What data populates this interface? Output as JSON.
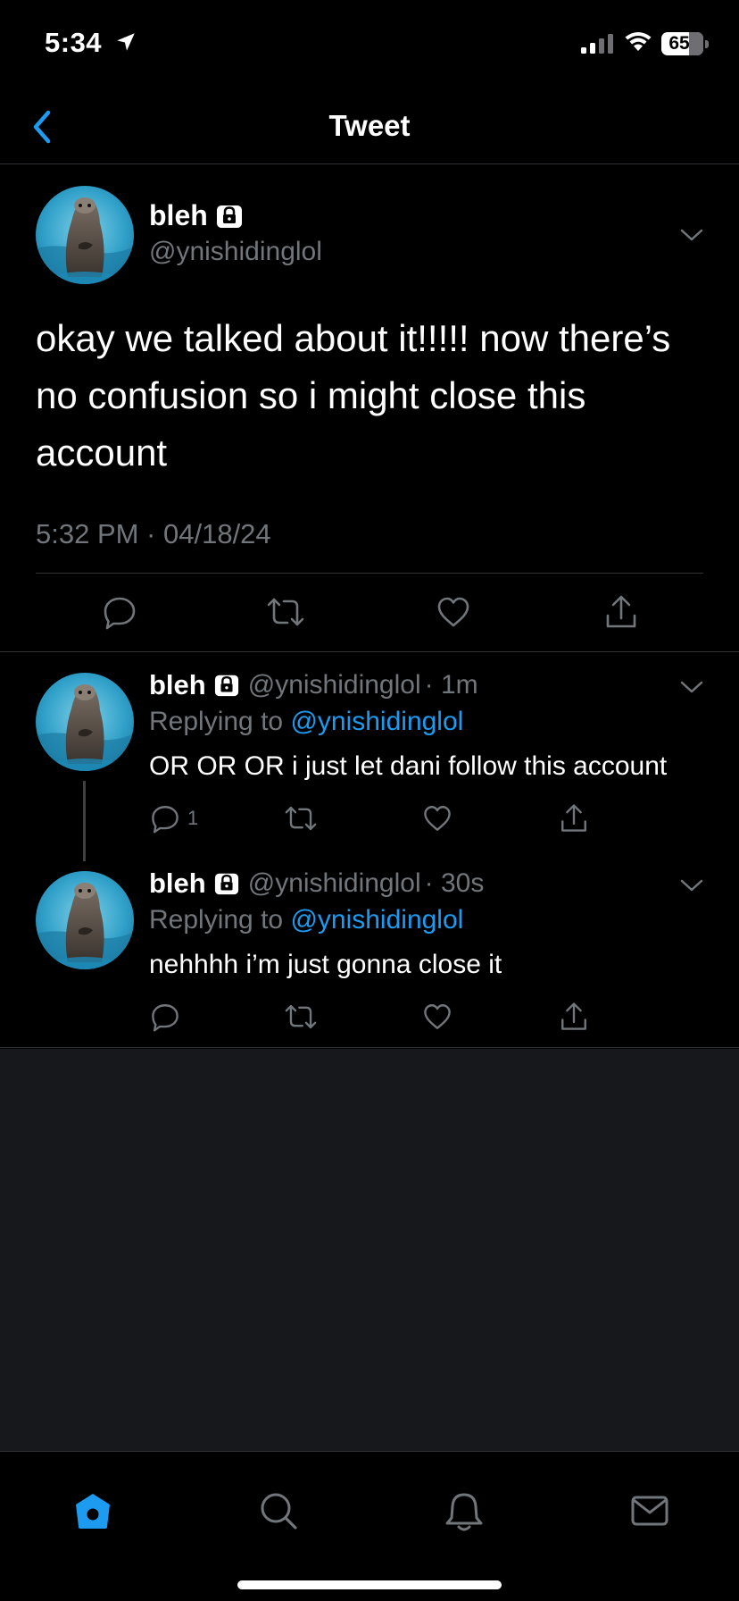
{
  "status_bar": {
    "time": "5:34",
    "battery_level": "65",
    "battery_fraction": 0.65
  },
  "nav": {
    "title": "Tweet"
  },
  "main_tweet": {
    "name": "bleh",
    "handle": "@ynishidinglol",
    "text": "okay we talked about it!!!!! now there’s no confusion so i might close this account",
    "timestamp": "5:32 PM · 04/18/24"
  },
  "replies": [
    {
      "name": "bleh",
      "handle": "@ynishidinglol",
      "age": "· 1m",
      "replying_prefix": "Replying to",
      "replying_to": "@ynishidinglol",
      "text": "OR OR OR i just let dani follow this account",
      "reply_count": "1"
    },
    {
      "name": "bleh",
      "handle": "@ynishidinglol",
      "age": "· 30s",
      "replying_prefix": "Replying to",
      "replying_to": "@ynishidinglol",
      "text": "nehhhh i’m just gonna close it"
    }
  ],
  "colors": {
    "accent": "#1d9bf0",
    "secondary_text": "#71767b",
    "background": "#000000",
    "empty_area": "#16181c"
  },
  "icons": {
    "tabs": [
      "home-icon",
      "search-icon",
      "notifications-icon",
      "messages-icon"
    ],
    "actions": [
      "reply-icon",
      "retweet-icon",
      "like-icon",
      "share-icon"
    ]
  }
}
